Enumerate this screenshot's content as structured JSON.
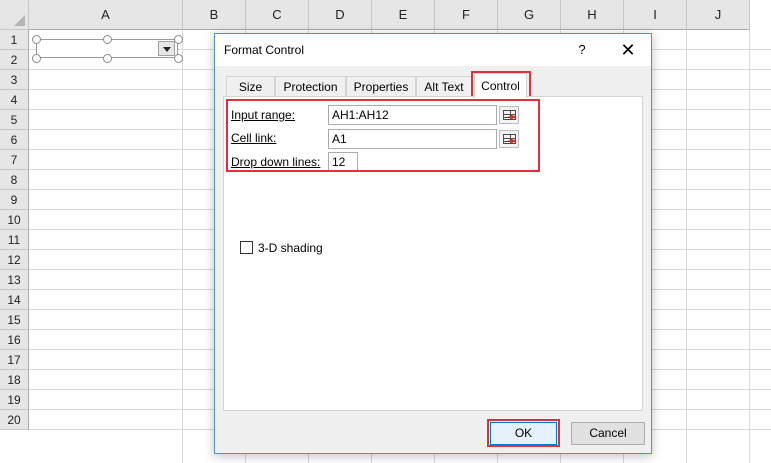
{
  "sheet": {
    "columns": [
      "A",
      "B",
      "C",
      "D",
      "E",
      "F",
      "G",
      "H",
      "I",
      "J"
    ],
    "rows": [
      "1",
      "2",
      "3",
      "4",
      "5",
      "6",
      "7",
      "8",
      "9",
      "10",
      "11",
      "12",
      "13",
      "14",
      "15",
      "16",
      "17",
      "18",
      "19",
      "20"
    ]
  },
  "dialog": {
    "title": "Format Control",
    "help": "?",
    "close": "✕",
    "tabs": [
      "Size",
      "Protection",
      "Properties",
      "Alt Text",
      "Control"
    ],
    "input_range": {
      "label": "Input range:",
      "value": "AH1:AH12"
    },
    "cell_link": {
      "label": "Cell link:",
      "value": "A1"
    },
    "drop_down_lines": {
      "label": "Drop down lines:",
      "value": "12"
    },
    "shading": {
      "label": "3-D shading",
      "checked": false
    },
    "ok": "OK",
    "cancel": "Cancel"
  },
  "colors": {
    "highlight": "#e0303a",
    "dialog_border": "#5a8fcf"
  }
}
